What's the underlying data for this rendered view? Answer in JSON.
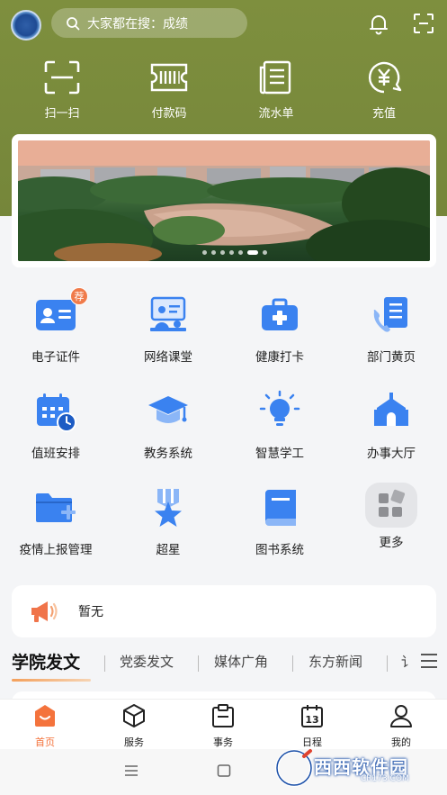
{
  "header": {
    "search_placeholder": "大家都在搜：成绩",
    "quick_actions": [
      {
        "label": "扫一扫",
        "icon": "scan-icon"
      },
      {
        "label": "付款码",
        "icon": "barcode-icon"
      },
      {
        "label": "流水单",
        "icon": "receipt-icon"
      },
      {
        "label": "充值",
        "icon": "yuan-coin-icon"
      }
    ]
  },
  "banner": {
    "slide_count": 7,
    "active_slide": 6
  },
  "grid": [
    {
      "label": "电子证件",
      "icon": "id-card-icon",
      "badge": "荐"
    },
    {
      "label": "网络课堂",
      "icon": "online-classroom-icon"
    },
    {
      "label": "健康打卡",
      "icon": "medical-kit-icon"
    },
    {
      "label": "部门黄页",
      "icon": "phone-book-icon"
    },
    {
      "label": "值班安排",
      "icon": "calendar-clock-icon"
    },
    {
      "label": "教务系统",
      "icon": "graduation-cap-icon"
    },
    {
      "label": "智慧学工",
      "icon": "lightbulb-icon"
    },
    {
      "label": "办事大厅",
      "icon": "hall-building-icon"
    },
    {
      "label": "疫情上报管理",
      "icon": "folder-add-icon"
    },
    {
      "label": "超星",
      "icon": "star-ribbon-icon"
    },
    {
      "label": "图书系统",
      "icon": "book-icon"
    },
    {
      "label": "更多",
      "icon": "more-grid-icon"
    }
  ],
  "notice": {
    "text": "暂无",
    "icon": "megaphone-icon"
  },
  "tabs": [
    {
      "label": "学院发文",
      "active": true
    },
    {
      "label": "党委发文"
    },
    {
      "label": "媒体广角"
    },
    {
      "label": "东方新闻"
    },
    {
      "label": "讠"
    }
  ],
  "bottom_nav": [
    {
      "label": "首页",
      "icon": "home-icon",
      "active": true
    },
    {
      "label": "服务",
      "icon": "cube-icon"
    },
    {
      "label": "事务",
      "icon": "clipboard-icon"
    },
    {
      "label": "日程",
      "icon": "calendar-icon",
      "day": "13"
    },
    {
      "label": "我的",
      "icon": "user-icon"
    }
  ],
  "watermark": {
    "text": "西西软件园",
    "sub": "CR173.COM"
  },
  "colors": {
    "header_bg": "#7e8f3e",
    "accent_orange": "#f4733c",
    "icon_blue": "#3a82f0"
  }
}
